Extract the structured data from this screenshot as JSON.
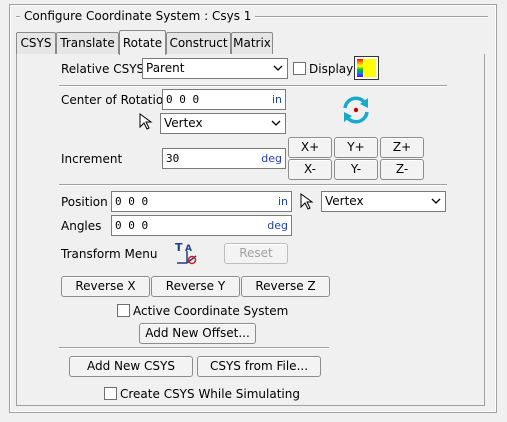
{
  "window": {
    "group_title": "Configure Coordinate System : Csys 1"
  },
  "tabs": [
    {
      "label": "CSYS"
    },
    {
      "label": "Translate"
    },
    {
      "label": "Rotate"
    },
    {
      "label": "Construct"
    },
    {
      "label": "Matrix"
    }
  ],
  "active_tab": "Rotate",
  "relative": {
    "label": "Relative CSYS",
    "value": "Parent",
    "display_label": "Display"
  },
  "center": {
    "label": "Center of Rotation",
    "value": "0 0 0",
    "unit": "in",
    "picker_value": "Vertex"
  },
  "increment": {
    "label": "Increment",
    "value": "30",
    "unit": "deg"
  },
  "rotate_buttons": {
    "xplus": "X+",
    "yplus": "Y+",
    "zplus": "Z+",
    "xminus": "X-",
    "yminus": "Y-",
    "zminus": "Z-"
  },
  "position": {
    "label": "Position",
    "value": "0 0 0",
    "unit": "in",
    "picker_value": "Vertex"
  },
  "angles": {
    "label": "Angles",
    "value": "0 0 0",
    "unit": "deg"
  },
  "transform": {
    "label": "Transform Menu",
    "reset_label": "Reset"
  },
  "reverse": {
    "x": "Reverse X",
    "y": "Reverse Y",
    "z": "Reverse Z"
  },
  "active_cs": {
    "label": "Active Coordinate System",
    "checked": false
  },
  "add_offset_label": "Add New Offset...",
  "add_csys_label": "Add New CSYS",
  "csys_from_file_label": "CSYS from File...",
  "create_while_sim": {
    "label": "Create CSYS While Simulating",
    "checked": false
  },
  "colors": {
    "unit_text": "#1d3fae",
    "swatch_yellow": "#ffff00",
    "rotate_icon": "#19a9c9"
  }
}
